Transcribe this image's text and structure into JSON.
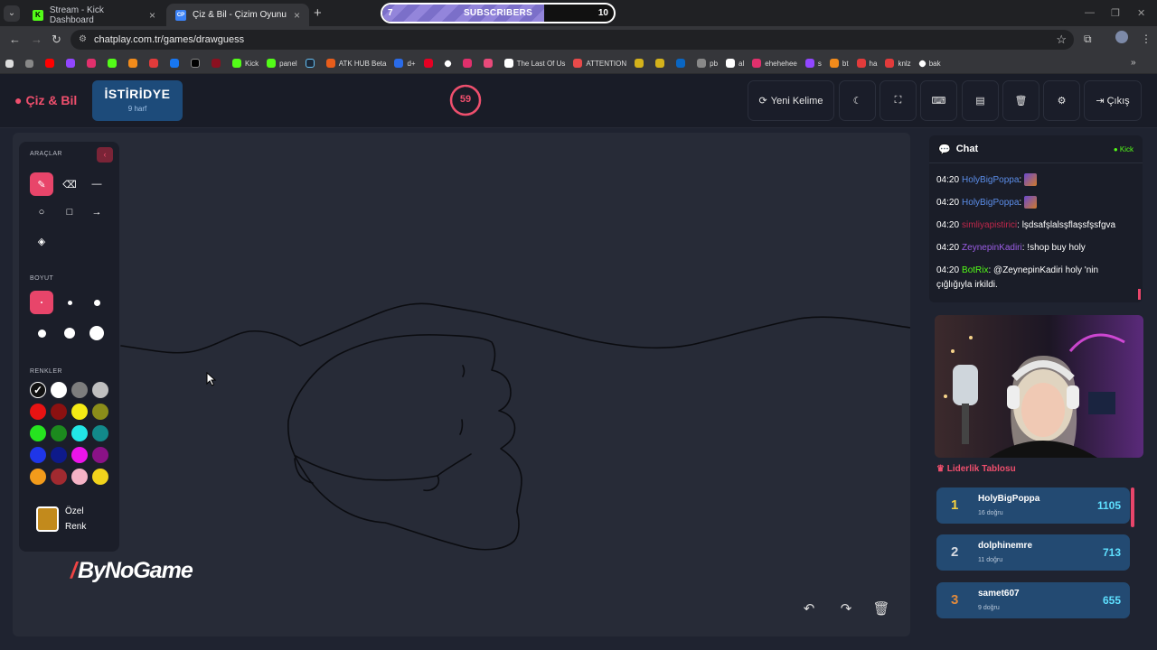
{
  "browser": {
    "tabs": [
      {
        "title": "Stream - Kick Dashboard"
      },
      {
        "title": "Çiz & Bil - Çizim Oyunu"
      }
    ],
    "url": "chatplay.com.tr/games/drawguess",
    "bookmarks": [
      "Kick",
      "panel",
      "ATK HUB Beta",
      "d+",
      "The Last Of Us",
      "ATTENTION",
      "pb",
      "al",
      "ehehehee",
      "s",
      "bt",
      "ha",
      "knlz",
      "bak"
    ]
  },
  "overlay": {
    "subscribers_label": "SUBSCRIBERS",
    "current": "7",
    "goal": "10",
    "progress": 0.7
  },
  "app": {
    "title": "Çiz & Bil",
    "word": "İSTİRİDYE",
    "letters": "9 harf",
    "timer": "59",
    "timer_fraction": 0.98,
    "buttons": {
      "new_word": "Yeni Kelime",
      "exit": "Çıkış"
    }
  },
  "tools": {
    "section_tools": "ARAÇLAR",
    "section_size": "BOYUT",
    "section_colors": "RENKLER",
    "custom_color_line1": "Özel",
    "custom_color_line2": "Renk",
    "colors": [
      "#111111",
      "#ffffff",
      "#7d7d7d",
      "#bfbfbf",
      "#e81313",
      "#8b1111",
      "#f4ea15",
      "#8b8d1a",
      "#26e41f",
      "#1c8a1e",
      "#22e6e6",
      "#12898a",
      "#1f36e8",
      "#0e1a8a",
      "#ec14ea",
      "#8a1286",
      "#f29b1b",
      "#a12a30",
      "#f5b3c6",
      "#f1d31c"
    ],
    "custom_color": "#c28a1c",
    "accent": "#e8456a"
  },
  "brand": "ByNoGame",
  "chat": {
    "title": "Chat",
    "platform": "Kick",
    "messages": [
      {
        "time": "04:20",
        "user": "HolyBigPoppa",
        "color": "#5b8de8",
        "text": ""
      },
      {
        "time": "04:20",
        "user": "HolyBigPoppa",
        "color": "#5b8de8",
        "text": ""
      },
      {
        "time": "04:20",
        "user": "simliyapistirici",
        "color": "#c1274b",
        "text": ": lşdsafşlalsşflaşsfşsfgva"
      },
      {
        "time": "04:20",
        "user": "ZeynepinKadiri",
        "color": "#9b5de5",
        "text": ": !shop buy holy"
      },
      {
        "time": "04:20",
        "user": "BotRix",
        "color": "#53fc18",
        "text": ": @ZeynepinKadiri holy 'nin çığlığıyla irkildi."
      }
    ]
  },
  "leaderboard": {
    "title": "Liderlik Tablosu",
    "rows": [
      {
        "rank": "1",
        "name": "HolyBigPoppa",
        "sub": "16 doğru",
        "score": "1105",
        "rank_color": "#f4d03f"
      },
      {
        "rank": "2",
        "name": "dolphinemre",
        "sub": "11 doğru",
        "score": "713",
        "rank_color": "#d7dbe2"
      },
      {
        "rank": "3",
        "name": "samet607",
        "sub": "9 doğru",
        "score": "655",
        "rank_color": "#e08a3c"
      }
    ]
  }
}
